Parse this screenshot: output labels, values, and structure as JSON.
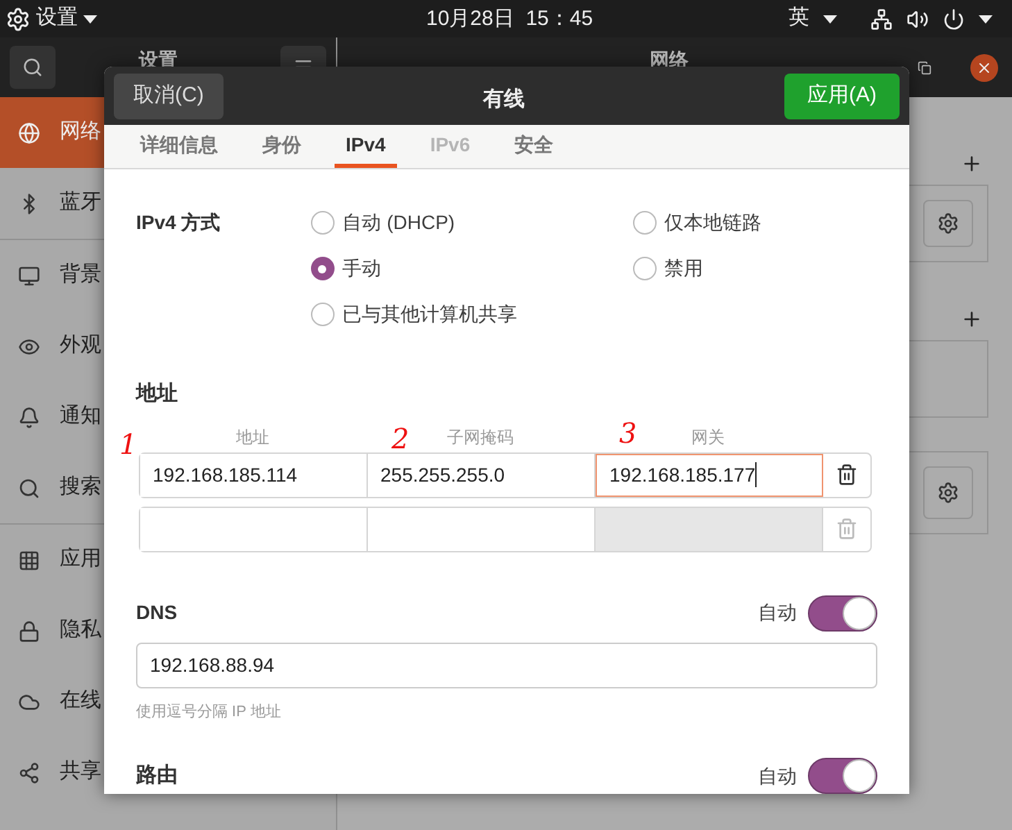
{
  "top_bar": {
    "app_menu": "设置",
    "clock": "10月28日  15：45",
    "input_method": "英"
  },
  "settings_window": {
    "sidebar_title": "设置",
    "content_title": "网络",
    "sidebar_items": [
      {
        "label": "网络",
        "selected": true
      },
      {
        "label": "蓝牙",
        "selected": false
      },
      {
        "label": "背景",
        "selected": false
      },
      {
        "label": "外观",
        "selected": false
      },
      {
        "label": "通知",
        "selected": false
      },
      {
        "label": "搜索",
        "selected": false
      },
      {
        "label": "应用",
        "selected": false
      },
      {
        "label": "隐私",
        "selected": false
      },
      {
        "label": "在线",
        "selected": false
      },
      {
        "label": "共享",
        "selected": false
      }
    ]
  },
  "dialog": {
    "title": "有线",
    "cancel": "取消(C)",
    "apply": "应用(A)",
    "tabs": [
      {
        "label": "详细信息",
        "selected": false,
        "disabled": false
      },
      {
        "label": "身份",
        "selected": false,
        "disabled": false
      },
      {
        "label": "IPv4",
        "selected": true,
        "disabled": false
      },
      {
        "label": "IPv6",
        "selected": false,
        "disabled": true
      },
      {
        "label": "安全",
        "selected": false,
        "disabled": false
      }
    ],
    "method_label": "IPv4 方式",
    "methods": [
      {
        "label": "自动 (DHCP)",
        "selected": false
      },
      {
        "label": "仅本地链路",
        "selected": false
      },
      {
        "label": "手动",
        "selected": true
      },
      {
        "label": "禁用",
        "selected": false
      },
      {
        "label": "已与其他计算机共享",
        "selected": false
      }
    ],
    "address_heading": "地址",
    "address_columns": [
      "地址",
      "子网掩码",
      "网关"
    ],
    "address_rows": [
      {
        "cells": [
          {
            "value": "192.168.185.114",
            "focused": false,
            "disabled": false
          },
          {
            "value": "255.255.255.0",
            "focused": false,
            "disabled": false
          },
          {
            "value": "192.168.185.177",
            "focused": true,
            "disabled": false
          }
        ],
        "delete_disabled": false
      },
      {
        "cells": [
          {
            "focused": false,
            "disabled": false
          },
          {
            "focused": false,
            "disabled": false
          },
          {
            "focused": false,
            "disabled": true
          }
        ],
        "delete_disabled": true
      }
    ],
    "dns": {
      "heading": "DNS",
      "auto_label": "自动",
      "on": true,
      "value": "192.168.88.94",
      "hint": "使用逗号分隔 IP 地址"
    },
    "routes": {
      "heading": "路由",
      "auto_label": "自动",
      "on": true
    }
  },
  "annotations": [
    "1",
    "2",
    "3"
  ]
}
